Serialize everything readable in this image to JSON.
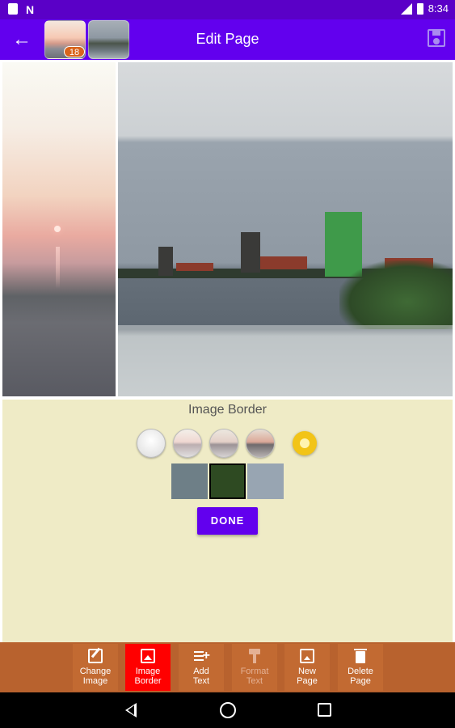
{
  "status_bar": {
    "time": "8:34",
    "left_icons": [
      "sd-card-icon",
      "n-notification-icon"
    ],
    "right_icons": [
      "signal-icon",
      "battery-icon"
    ]
  },
  "app_bar": {
    "title": "Edit Page",
    "thumbnail_badge": "18",
    "back_icon": "arrow-back-icon",
    "save_icon": "save-icon"
  },
  "panel": {
    "title": "Image Border",
    "done_label": "DONE",
    "circle_swatches": [
      "border-white",
      "border-sunset-light",
      "border-sunset-medium",
      "border-sunset-dark"
    ],
    "color_squares": [
      "#6e7f87",
      "#2e4a22",
      "#98a5b2"
    ],
    "picker_color": "#f2c417"
  },
  "toolbar": {
    "items": [
      {
        "label": "Change\nImage",
        "icon": "edit-image-icon",
        "state": "normal"
      },
      {
        "label": "Image\nBorder",
        "icon": "image-border-icon",
        "state": "active"
      },
      {
        "label": "Add\nText",
        "icon": "add-text-icon",
        "state": "normal"
      },
      {
        "label": "Format\nText",
        "icon": "format-paint-icon",
        "state": "disabled"
      },
      {
        "label": "New\nPage",
        "icon": "new-page-icon",
        "state": "normal"
      },
      {
        "label": "Delete\nPage",
        "icon": "delete-icon",
        "state": "normal"
      }
    ],
    "active_color": "#ff0000",
    "bar_color": "#b8622e"
  },
  "colors": {
    "primary": "#6200ee",
    "status_bar": "#5a00c7",
    "panel_bg": "#efebc6"
  }
}
